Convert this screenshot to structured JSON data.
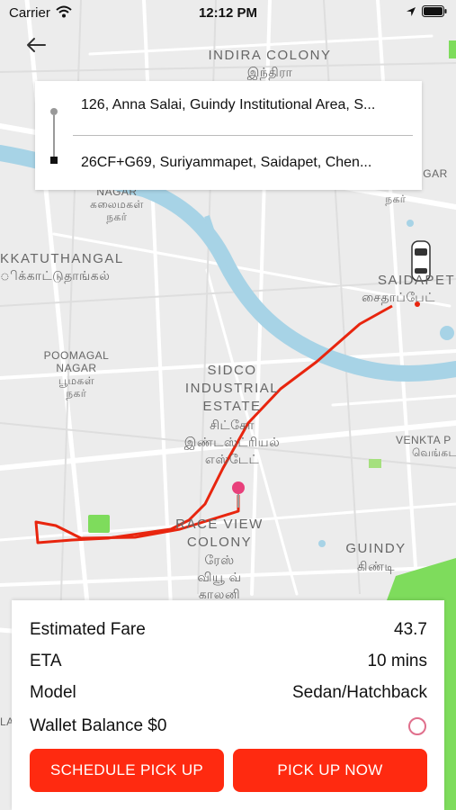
{
  "status_bar": {
    "carrier": "Carrier",
    "time": "12:12 PM"
  },
  "trip": {
    "pickup_address": "126, Anna Salai, Guindy Institutional Area, S...",
    "drop_address": "26CF+G69, Suriyammapet, Saidapet, Chen..."
  },
  "map": {
    "labels": {
      "indira_colony": "INDIRA COLONY",
      "indira_colony_ta": "இந்திரா",
      "nagar_top": "NAGAR",
      "nagar_top_ta": "கலைமகள்",
      "nagar_top_ta2": "நகர்",
      "nagar_right": "நகர்",
      "kkatuthangal": "KKATUTHANGAL",
      "kkatuthangal_ta": "ிக்காட்டுதாங்கல்",
      "gar": "GAR",
      "saidapet": "SAIDAPET",
      "saidapet_ta": "சைதாப்பேட்",
      "poomagal": "POOMAGAL",
      "poomagal_nagar": "NAGAR",
      "poomagal_ta": "பூமகள்",
      "poomagal_ta2": "நகர்",
      "sidco1": "SIDCO",
      "sidco2": "INDUSTRIAL",
      "sidco3": "ESTATE",
      "sidco_ta1": "சிட்கோ",
      "sidco_ta2": "இண்டஸ்ட்ரியல்",
      "sidco_ta3": "எஸ்டேட்",
      "venkta": "VENKTA P",
      "venkta_ta": "வெங்கட",
      "race1": "RACE VIEW",
      "race2": "COLONY",
      "race_ta1": "ரேஸ்",
      "race_ta2": "வியூ வ்",
      "race_ta3": "காலனி",
      "guindy": "GUINDY",
      "guindy_ta": "கிண்டி",
      "edge_la": "LA"
    }
  },
  "fare_panel": {
    "estimated_fare_label": "Estimated Fare",
    "estimated_fare_value": "43.7",
    "eta_label": "ETA",
    "eta_value": "10 mins",
    "model_label": "Model",
    "model_value": "Sedan/Hatchback",
    "wallet_label": "Wallet Balance $0",
    "schedule_button": "SCHEDULE PICK UP",
    "pickup_button": "PICK UP NOW"
  },
  "colors": {
    "accent": "#ff2a10",
    "route": "#e8250e",
    "water": "#a7d3e6",
    "park": "#7edc5c",
    "radio": "#e06f8c"
  },
  "icons": {
    "back": "arrow-left-icon",
    "pin": "map-pin-icon",
    "car": "car-icon",
    "wifi": "wifi-icon",
    "location": "location-arrow-icon",
    "battery": "battery-icon"
  }
}
